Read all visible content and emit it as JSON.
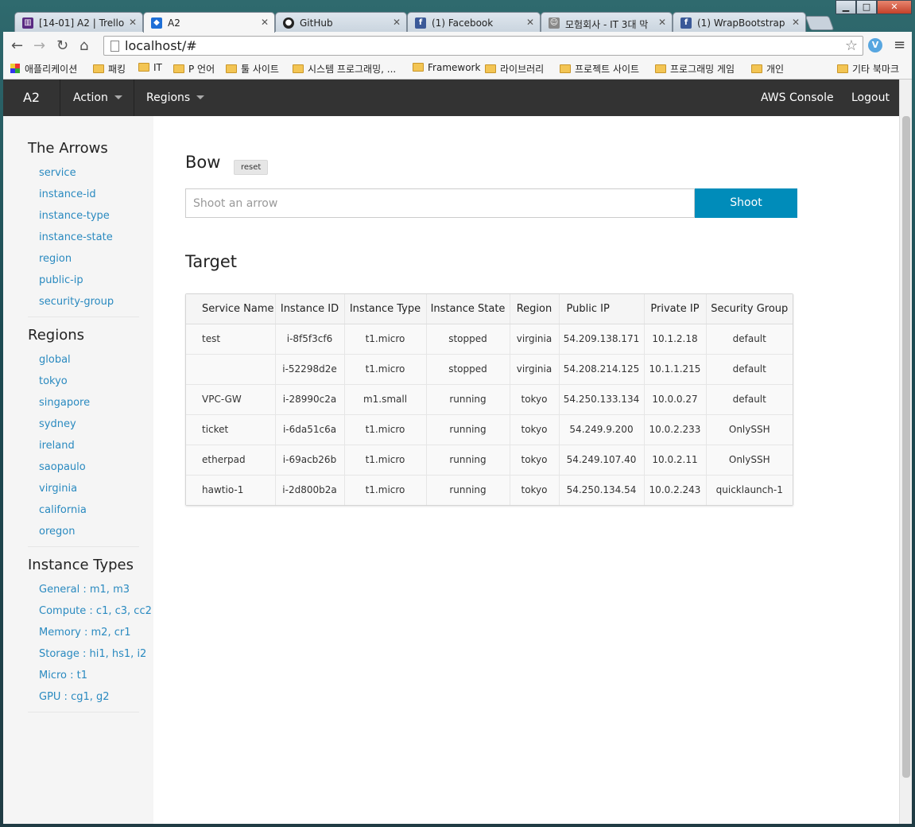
{
  "browser": {
    "tabs": [
      {
        "label": "[14-01] A2 | Trello",
        "icon": "trello-icon",
        "color": "#5a2a82"
      },
      {
        "label": "A2",
        "icon": "a2-icon",
        "color": "#1e6fd6",
        "active": true
      },
      {
        "label": "GitHub",
        "icon": "github-icon",
        "color": "#222222"
      },
      {
        "label": "(1) Facebook",
        "icon": "facebook-icon",
        "color": "#3b5998"
      },
      {
        "label": "모험회사 - IT 3대 막",
        "icon": "page-icon",
        "color": "#888888"
      },
      {
        "label": "(1) WrapBootstrap",
        "icon": "facebook-icon",
        "color": "#3b5998"
      }
    ],
    "url": "localhost/#",
    "bookmarks": [
      "애플리케이션",
      "패킹",
      "IT",
      "P 언어",
      "툴 사이트",
      "시스템 프로그래밍, ...",
      "Framework",
      "라이브러리",
      "프로젝트 사이트",
      "프로그래밍 게임",
      "개인"
    ],
    "other_bookmarks": "기타 북마크"
  },
  "navbar": {
    "brand": "A2",
    "action": "Action",
    "regions": "Regions",
    "aws_console": "AWS Console",
    "logout": "Logout"
  },
  "sidebar": {
    "arrows_heading": "The Arrows",
    "arrows": [
      "service",
      "instance-id",
      "instance-type",
      "instance-state",
      "region",
      "public-ip",
      "security-group"
    ],
    "regions_heading": "Regions",
    "regions": [
      "global",
      "tokyo",
      "singapore",
      "sydney",
      "ireland",
      "saopaulo",
      "virginia",
      "california",
      "oregon"
    ],
    "types_heading": "Instance Types",
    "types": [
      "General : m1, m3",
      "Compute : c1, c3, cc2",
      "Memory : m2, cr1",
      "Storage : hi1, hs1, i2",
      "Micro : t1",
      "GPU : cg1, g2"
    ]
  },
  "bow": {
    "title": "Bow",
    "reset": "reset",
    "placeholder": "Shoot an arrow",
    "shoot": "Shoot"
  },
  "target": {
    "title": "Target",
    "columns": [
      "Service Name",
      "Instance ID",
      "Instance Type",
      "Instance State",
      "Region",
      "Public IP",
      "Private IP",
      "Security Group"
    ],
    "rows": [
      [
        "test",
        "i-8f5f3cf6",
        "t1.micro",
        "stopped",
        "virginia",
        "54.209.138.171",
        "10.1.2.18",
        "default"
      ],
      [
        "",
        "i-52298d2e",
        "t1.micro",
        "stopped",
        "virginia",
        "54.208.214.125",
        "10.1.1.215",
        "default"
      ],
      [
        "VPC-GW",
        "i-28990c2a",
        "m1.small",
        "running",
        "tokyo",
        "54.250.133.134",
        "10.0.0.27",
        "default"
      ],
      [
        "ticket",
        "i-6da51c6a",
        "t1.micro",
        "running",
        "tokyo",
        "54.249.9.200",
        "10.0.2.233",
        "OnlySSH"
      ],
      [
        "etherpad",
        "i-69acb26b",
        "t1.micro",
        "running",
        "tokyo",
        "54.249.107.40",
        "10.0.2.11",
        "OnlySSH"
      ],
      [
        "hawtio-1",
        "i-2d800b2a",
        "t1.micro",
        "running",
        "tokyo",
        "54.250.134.54",
        "10.0.2.243",
        "quicklaunch-1"
      ]
    ]
  },
  "colors": {
    "navbar": "#333333",
    "link": "#2a8ac0",
    "primary_button": "#008cba"
  }
}
